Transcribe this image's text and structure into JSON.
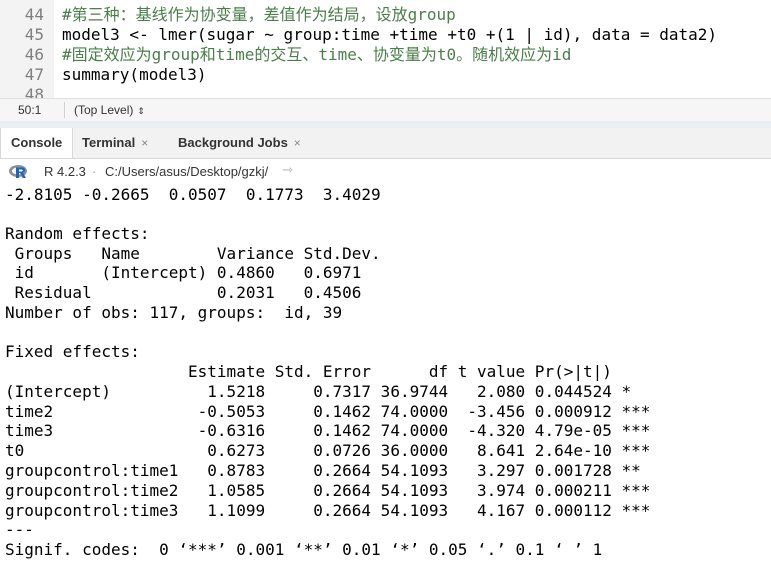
{
  "editor": {
    "lines": [
      {
        "num": "44",
        "text": "#第三种：基线作为协变量，差值作为结局，设放group"
      },
      {
        "num": "45",
        "text": "model3 <- lmer(sugar ~ group:time +time +t0 +(1 | id), data = data2)"
      },
      {
        "num": "46",
        "text": "#固定效应为group和time的交互、time、协变量为t0。随机效应为id"
      },
      {
        "num": "47",
        "text": "summary(model3)"
      },
      {
        "num": "48",
        "text": ""
      }
    ]
  },
  "status": {
    "position": "50:1",
    "scope": "(Top Level)",
    "updown": "⇕"
  },
  "tabs": [
    {
      "label": "Console",
      "close": ""
    },
    {
      "label": "Terminal",
      "close": "×"
    },
    {
      "label": "Background Jobs",
      "close": "×"
    }
  ],
  "pathbar": {
    "r_version": "R 4.2.3",
    "separator": "·",
    "path": "C:/Users/asus/Desktop/gzkj/",
    "arrow": "⇾"
  },
  "console": {
    "lines": [
      "-2.8105 -0.2665  0.0507  0.1773  3.4029",
      "",
      "Random effects:",
      " Groups   Name        Variance Std.Dev.",
      " id       (Intercept) 0.4860   0.6971  ",
      " Residual             0.2031   0.4506  ",
      "Number of obs: 117, groups:  id, 39",
      "",
      "Fixed effects:",
      "                   Estimate Std. Error      df t value Pr(>|t|)    ",
      "(Intercept)          1.5218     0.7317 36.9744   2.080 0.044524 *  ",
      "time2               -0.5053     0.1462 74.0000  -3.456 0.000912 ***",
      "time3               -0.6316     0.1462 74.0000  -4.320 4.79e-05 ***",
      "t0                   0.6273     0.0726 36.0000   8.641 2.64e-10 ***",
      "groupcontrol:time1   0.8783     0.2664 54.1093   3.297 0.001728 ** ",
      "groupcontrol:time2   1.0585     0.2664 54.1093   3.974 0.000211 ***",
      "groupcontrol:time3   1.1099     0.2664 54.1093   4.167 0.000112 ***",
      "---",
      "Signif. codes:  0 ‘***’ 0.001 ‘**’ 0.01 ‘*’ 0.05 ‘.’ 0.1 ‘ ’ 1"
    ]
  }
}
